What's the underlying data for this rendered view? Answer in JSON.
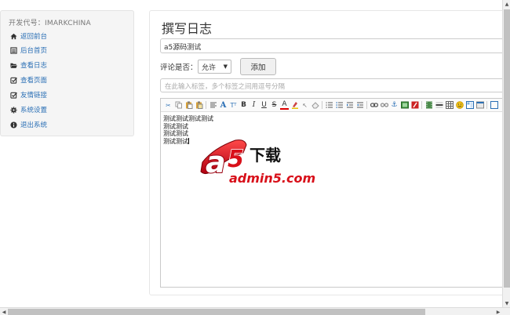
{
  "sidebar": {
    "title": "开发代号：IMARKCHINA",
    "items": [
      {
        "label": "返回前台",
        "icon": "home-icon"
      },
      {
        "label": "后台首页",
        "icon": "list-icon"
      },
      {
        "label": "查看日志",
        "icon": "folder-open-icon"
      },
      {
        "label": "查看页面",
        "icon": "edit-check-icon"
      },
      {
        "label": "友情链接",
        "icon": "edit-check-icon"
      },
      {
        "label": "系统设置",
        "icon": "gear-icon"
      },
      {
        "label": "退出系统",
        "icon": "info-icon"
      }
    ]
  },
  "main": {
    "title": "撰写日志",
    "post_title_value": "a5源码测试",
    "comment_label": "评论是否：",
    "comment_select_value": "允许",
    "add_button_label": "添加",
    "tag_placeholder": "在此输入标签，多个标签之间用逗号分隔",
    "editor_lines": [
      "测试测试测试测试",
      "测试测试",
      "测试测试",
      "测试测试"
    ]
  },
  "watermark": {
    "brand": "a5下载",
    "site": "admin5.com"
  },
  "colors": {
    "link": "#2a6fb5",
    "watermark_red": "#d8101a"
  }
}
